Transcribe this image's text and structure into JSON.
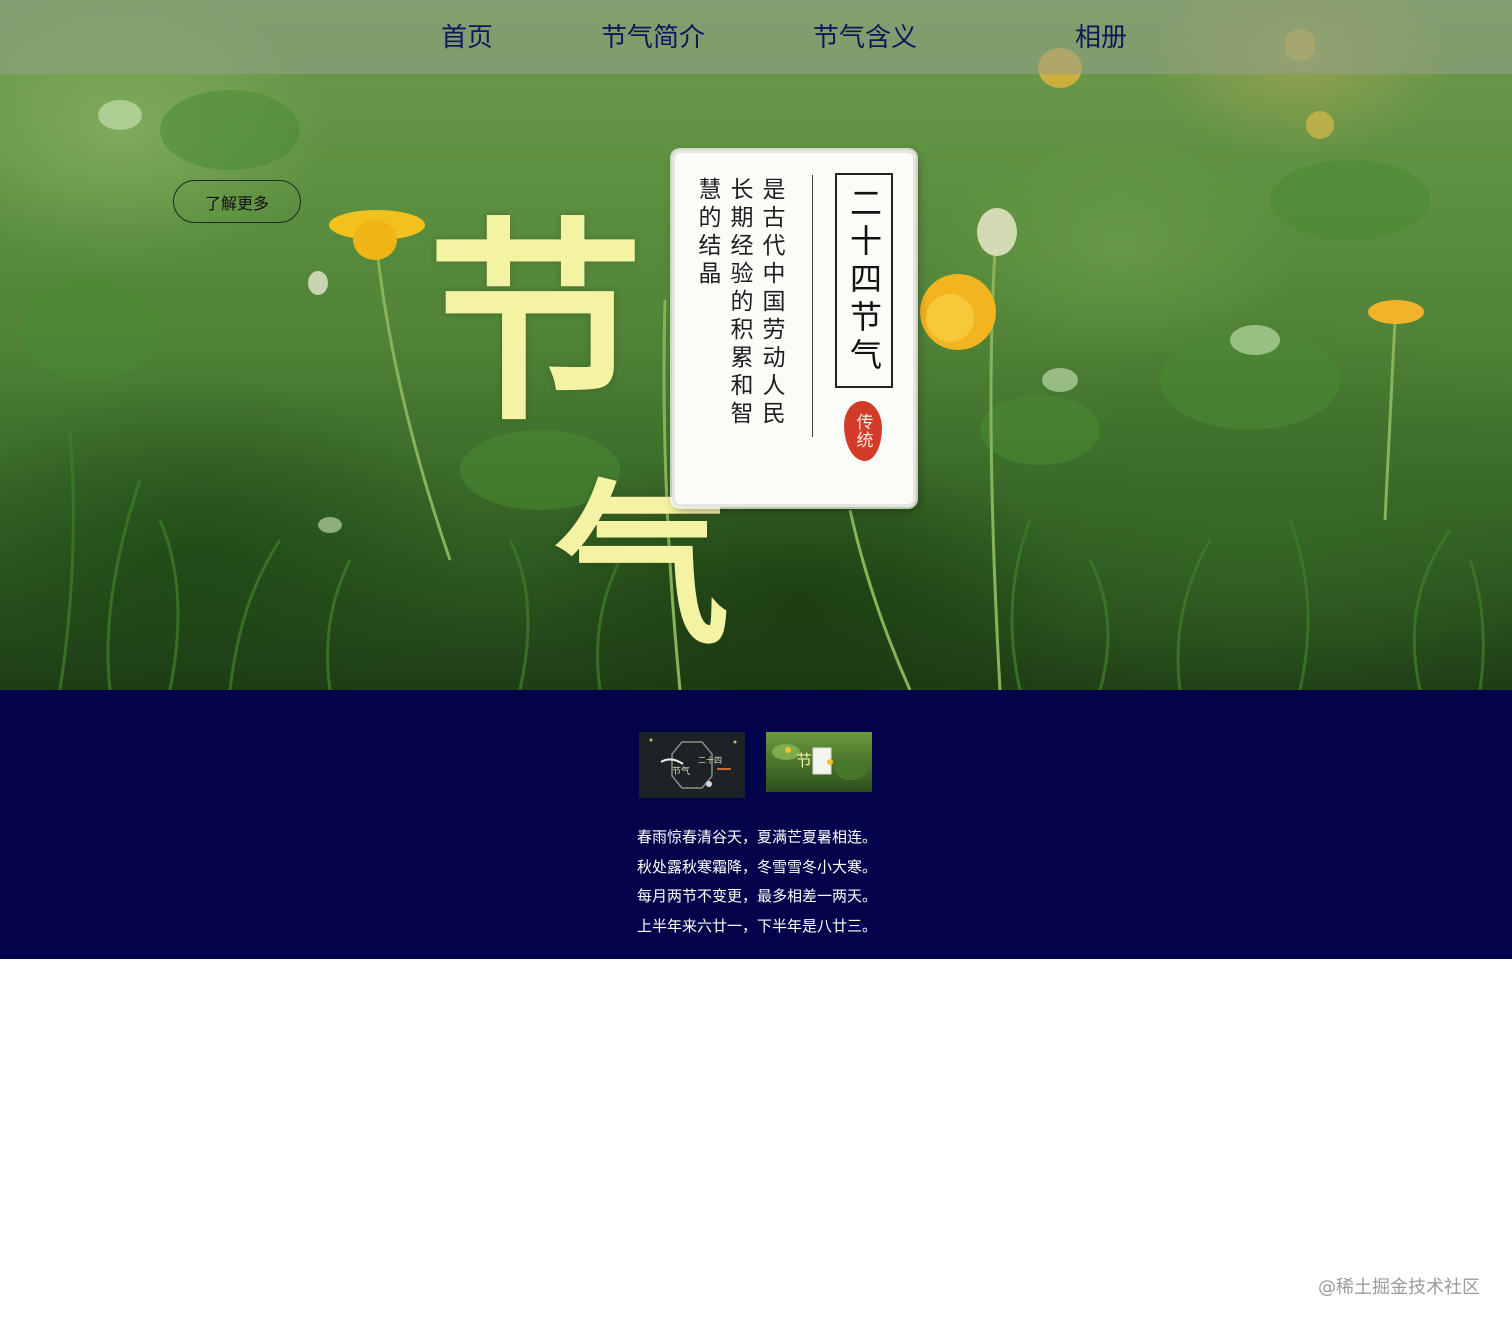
{
  "nav": {
    "items": [
      {
        "label": "首页"
      },
      {
        "label": "节气简介"
      },
      {
        "label": "节气含义"
      },
      {
        "label": "相册"
      }
    ]
  },
  "hero": {
    "button_label": "了解更多",
    "big_chars": [
      "节",
      "气"
    ],
    "card": {
      "title": "二十四节气",
      "columns": [
        "是古代中国劳动人民",
        "长期经验的积累和智",
        "慧的结晶"
      ],
      "seal_text": "传统"
    }
  },
  "gallery": {
    "thumbs": [
      {
        "name": "thumbnail-dark",
        "caption": "二十四",
        "sub": "节气"
      },
      {
        "name": "thumbnail-green",
        "caption": "节"
      }
    ]
  },
  "poem": {
    "lines": [
      "春雨惊春清谷天，夏满芒夏暑相连。",
      "秋处露秋寒霜降，冬雪雪冬小大寒。",
      "每月两节不变更，最多相差一两天。",
      "上半年来六廿一，下半年是八廿三。"
    ]
  },
  "watermark": "@稀土掘金技术社区",
  "colors": {
    "band_background": "#02034a",
    "nav_text": "#0b1a5a",
    "big_char": "#f4f3a4",
    "seal": "#d23a2a"
  }
}
